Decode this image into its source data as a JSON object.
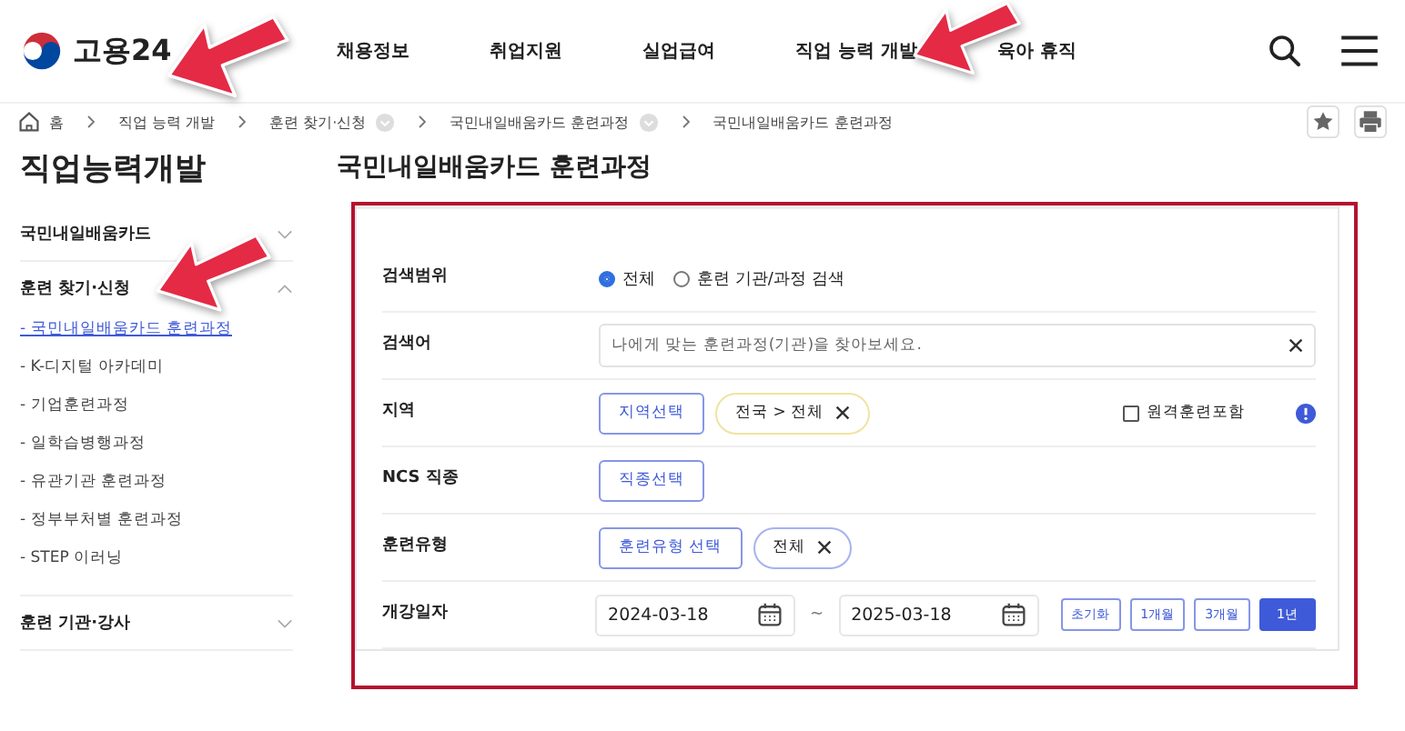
{
  "header": {
    "logo": "고용24",
    "nav": [
      {
        "label": "채용정보",
        "selected": false
      },
      {
        "label": "취업지원",
        "selected": false
      },
      {
        "label": "실업급여",
        "selected": false
      },
      {
        "label": "직업 능력 개발",
        "selected": false
      },
      {
        "label": "육아 휴직",
        "selected": false
      }
    ]
  },
  "breadcrumb": [
    {
      "label": "홈",
      "kind": "home",
      "dropdown": false
    },
    {
      "label": "직업 능력 개발",
      "kind": "text",
      "dropdown": false
    },
    {
      "label": "훈련 찾기·신청",
      "kind": "text",
      "dropdown": true
    },
    {
      "label": "국민내일배움카드 훈련과정",
      "kind": "text",
      "dropdown": true
    },
    {
      "label": "국민내일배움카드 훈련과정",
      "kind": "text",
      "dropdown": false
    }
  ],
  "sidebar": {
    "title": "직업능력개발",
    "sections": [
      {
        "label": "국민내일배움카드",
        "expanded": false
      },
      {
        "label": "훈련 찾기·신청",
        "expanded": true,
        "children": [
          {
            "label": "- 국민내일배움카드 훈련과정",
            "selected": true
          },
          {
            "label": "- K-디지털 아카데미",
            "selected": false
          },
          {
            "label": "- 기업훈련과정",
            "selected": false
          },
          {
            "label": "- 일학습병행과정",
            "selected": false
          },
          {
            "label": "- 유관기관 훈련과정",
            "selected": false
          },
          {
            "label": "- 정부부처별 훈련과정",
            "selected": false
          },
          {
            "label": "- STEP 이러닝",
            "selected": false
          }
        ]
      },
      {
        "label": "훈련 기관·강사",
        "expanded": false
      }
    ]
  },
  "main": {
    "title": "국민내일배움카드 훈련과정",
    "form": [
      {
        "label": "검색범위",
        "kind": "radio",
        "options": [
          {
            "label": "전체",
            "selected": true
          },
          {
            "label": "훈련 기관/과정 검색",
            "selected": false
          }
        ]
      },
      {
        "label": "검색어",
        "kind": "text",
        "placeholder": "나에게 맞는 훈련과정(기관)을 찾아보세요."
      },
      {
        "label": "지역",
        "kind": "select",
        "button": "지역선택",
        "chips": [
          {
            "label": "전국 > 전체",
            "color": "#f1e3a0"
          }
        ],
        "checkbox": {
          "label": "원격훈련포함",
          "checked": false
        }
      },
      {
        "label": "NCS 직종",
        "kind": "select",
        "button": "직종선택"
      },
      {
        "label": "훈련유형",
        "kind": "select",
        "button": "훈련유형 선택",
        "chips": [
          {
            "label": "전체",
            "color": "#a7b2f0"
          }
        ]
      },
      {
        "label": "개강일자",
        "kind": "daterange",
        "from": "2024-03-18",
        "to": "2025-03-18",
        "separator": "~",
        "presets": [
          {
            "label": "초기화",
            "selected": false
          },
          {
            "label": "1개월",
            "selected": false
          },
          {
            "label": "3개월",
            "selected": false
          },
          {
            "label": "1년",
            "selected": true
          }
        ]
      }
    ]
  }
}
